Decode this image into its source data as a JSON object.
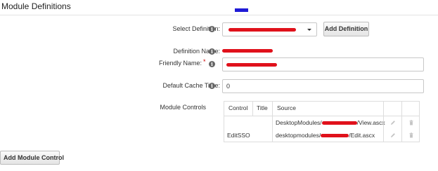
{
  "section": {
    "title": "Module Definitions"
  },
  "colors": {
    "accent_mark": "#1f1ad6",
    "redaction": "#e0111b",
    "required_star": "#cc0000",
    "info_icon": "#666666"
  },
  "form": {
    "select_definition": {
      "label": "Select Definition:",
      "icon": "info-icon",
      "button_label": "Add Definition"
    },
    "definition_name": {
      "label": "Definition Name:",
      "icon": "info-icon"
    },
    "friendly_name": {
      "label": "Friendly Name:",
      "required_mark": "*",
      "icon": "info-icon"
    },
    "default_cache_time": {
      "label": "Default Cache Time:",
      "icon": "info-icon",
      "value": "0"
    },
    "module_controls": {
      "label": "Module Controls"
    }
  },
  "controls_table": {
    "columns": [
      "Control",
      "Title",
      "Source"
    ],
    "rows": [
      {
        "control": "",
        "title": "",
        "source_prefix": "DesktopModules/",
        "source_suffix": "/View.ascx",
        "edit_icon": "pencil-icon",
        "delete_icon": "trash-icon"
      },
      {
        "control": "EditSSO",
        "title": "",
        "source_prefix": "desktopmodules/",
        "source_suffix": "/Edit.ascx",
        "edit_icon": "pencil-icon",
        "delete_icon": "trash-icon"
      }
    ]
  },
  "footer": {
    "add_module_control_label": "Add Module Control"
  }
}
